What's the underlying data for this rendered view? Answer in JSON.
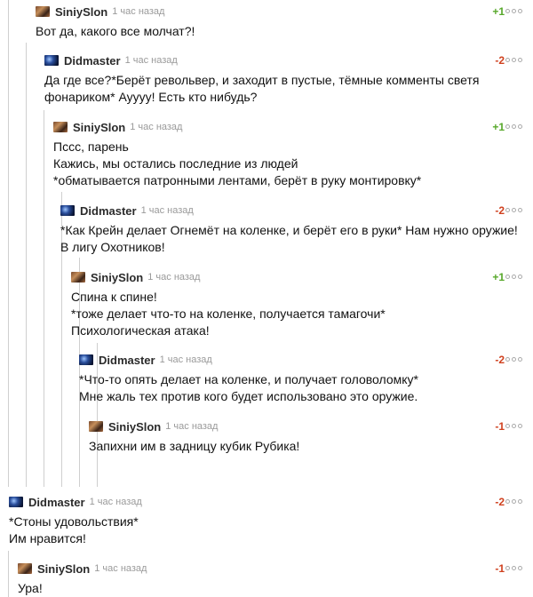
{
  "comments": [
    {
      "author": "SiniySlon",
      "time": "1 час назад",
      "rating": "+1",
      "avatar": "siniyslon-avatar",
      "body": "Вот да, какого все молчат?!"
    },
    {
      "author": "Didmaster",
      "time": "1 час назад",
      "rating": "-2",
      "avatar": "didmaster-avatar",
      "body": "Да где все?*Берёт револьвер, и заходит в пустые, тёмные комменты светя\nфонариком* Ауууу! Есть кто нибудь?"
    },
    {
      "author": "SiniySlon",
      "time": "1 час назад",
      "rating": "+1",
      "avatar": "siniyslon-avatar",
      "body": "Пссс, парень\nКажись, мы остались последние из людей\n*обматывается патронными лентами, берёт в руку монтировку*"
    },
    {
      "author": "Didmaster",
      "time": "1 час назад",
      "rating": "-2",
      "avatar": "didmaster-avatar",
      "body": "*Как Крейн делает Огнемёт на коленке, и берёт его в руки* Нам нужно оружие!\nВ лигу Охотников!"
    },
    {
      "author": "SiniySlon",
      "time": "1 час назад",
      "rating": "+1",
      "avatar": "siniyslon-avatar",
      "body": "Спина к спине!\n*тоже делает что-то на коленке, получается тамагочи*\nПсихологическая атака!"
    },
    {
      "author": "Didmaster",
      "time": "1 час назад",
      "rating": "-2",
      "avatar": "didmaster-avatar",
      "body": "*Что-то опять делает на коленке, и получает головоломку*\n Мне жаль тех против кого будет использовано это оружие."
    },
    {
      "author": "SiniySlon",
      "time": "1 час назад",
      "rating": "-1",
      "avatar": "siniyslon-avatar",
      "body": "Запихни им в задницу кубик Рубика!"
    },
    {
      "author": "Didmaster",
      "time": "1 час назад",
      "rating": "-2",
      "avatar": "didmaster-avatar",
      "body": "*Стоны удовольствия*\n Им нравится!"
    },
    {
      "author": "SiniySlon",
      "time": "1 час назад",
      "rating": "-1",
      "avatar": "siniyslon-avatar",
      "body": "Ура!"
    }
  ]
}
